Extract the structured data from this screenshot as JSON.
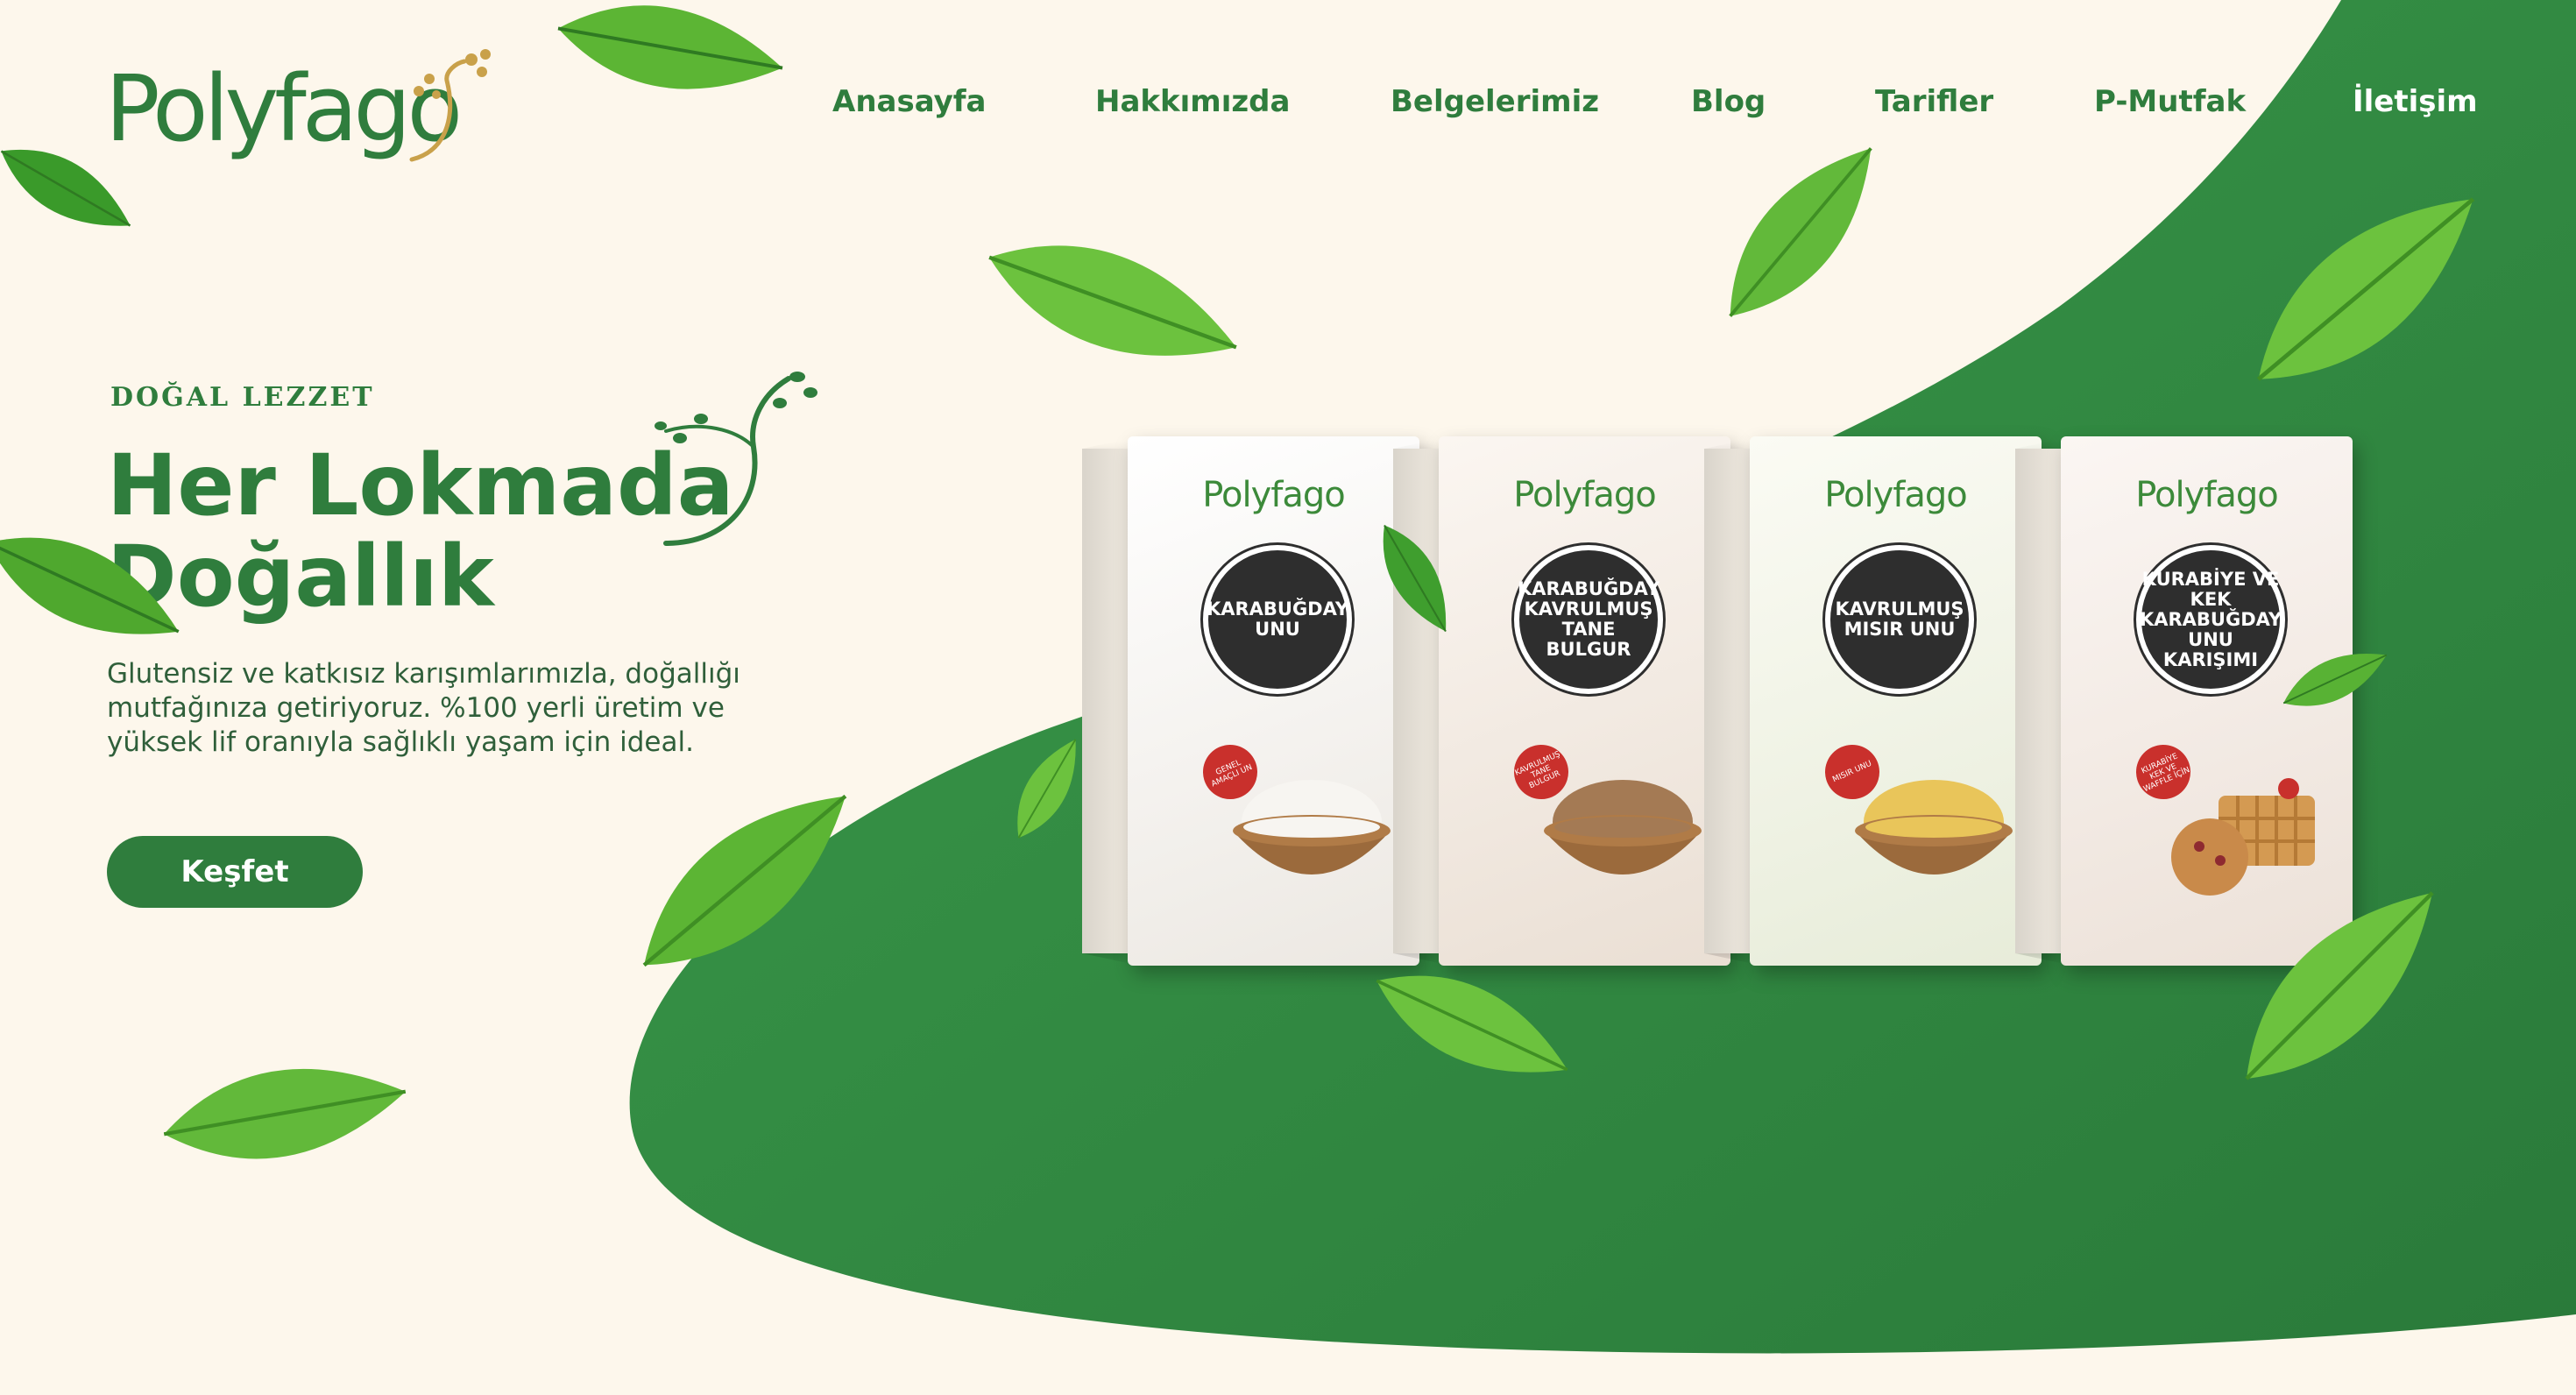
{
  "brand": {
    "logo_text": "Polyfago"
  },
  "nav": {
    "items": [
      {
        "label": "Anasayfa"
      },
      {
        "label": "Hakkımızda"
      },
      {
        "label": "Belgelerimiz"
      },
      {
        "label": "Blog"
      },
      {
        "label": "Tarifler"
      },
      {
        "label": "P-Mutfak"
      },
      {
        "label": "İletişim"
      }
    ]
  },
  "hero": {
    "eyebrow": "DOĞAL LEZZET",
    "headline_line1": "Her Lokmada",
    "headline_line2": "Doğallık",
    "description": "Glutensiz ve katkısız karışımlarımızla, doğallığı mutfağınıza getiriyoruz. %100 yerli üretim ve yüksek lif oranıyla sağlıklı yaşam için ideal.",
    "cta_label": "Keşfet"
  },
  "products": [
    {
      "brand": "Polyfago",
      "name": "KARABUĞDAY UNU",
      "tag": "GENEL AMAÇLI UN",
      "fill_color": "#f7f5f1"
    },
    {
      "brand": "Polyfago",
      "name": "KARABUĞDAY KAVRULMUŞ TANE BULGUR",
      "tag": "KAVRULMUŞ TANE BULGUR",
      "fill_color": "#a47a54"
    },
    {
      "brand": "Polyfago",
      "name": "KAVRULMUŞ MISIR UNU",
      "tag": "MISIR UNU",
      "fill_color": "#e9c55a"
    },
    {
      "brand": "Polyfago",
      "name": "KURABİYE VE KEK KARABUĞDAY UNU KARIŞIMI",
      "tag": "KURABİYE KEK VE WAFFLE İÇİN",
      "fill_color": "#c98a4a"
    }
  ],
  "colors": {
    "brand_green": "#2f7d3d",
    "background": "#fdf7ec",
    "accent_gold": "#c9a14a"
  }
}
